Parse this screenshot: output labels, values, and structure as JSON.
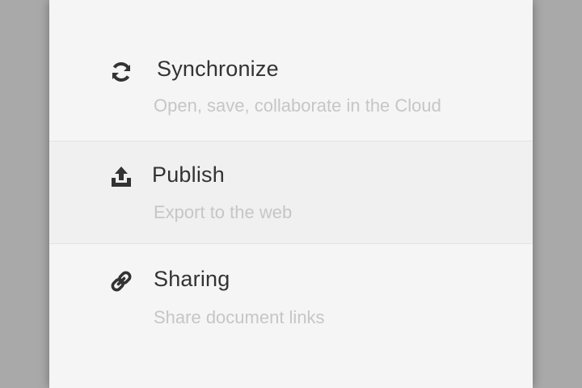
{
  "menu": {
    "items": [
      {
        "icon": "sync-icon",
        "label": "Synchronize",
        "description": "Open, save, collaborate in the Cloud"
      },
      {
        "icon": "upload-icon",
        "label": "Publish",
        "description": "Export to the web"
      },
      {
        "icon": "link-icon",
        "label": "Sharing",
        "description": "Share document links"
      }
    ]
  },
  "colors": {
    "backdrop": "#a9a9a9",
    "panel": "#f5f5f5",
    "hover_row": "#f0f0f0",
    "label": "#333333",
    "description": "#c6c6c6"
  }
}
